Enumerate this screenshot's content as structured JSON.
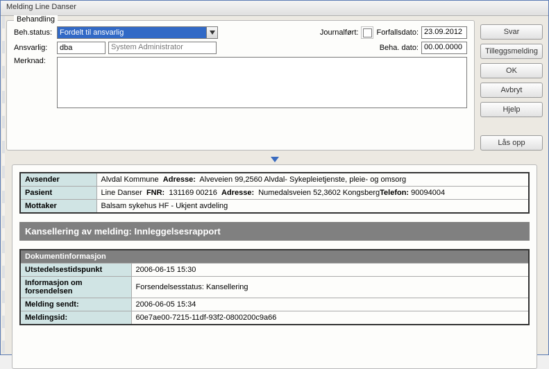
{
  "window": {
    "title": "Melding Line Danser"
  },
  "behandling": {
    "legend": "Behandling",
    "beh_status_label": "Beh.status:",
    "beh_status_value": "Fordelt til ansvarlig",
    "ansvarlig_label": "Ansvarlig:",
    "ansvarlig_value": "dba",
    "ansvarlig_name": "System Administrator",
    "merknad_label": "Merknad:",
    "journalfort_label": "Journalført:",
    "forfallsdato_label": "Forfallsdato:",
    "forfallsdato_value": "23.09.2012",
    "behadato_label": "Beha. dato:",
    "behadato_value": "00.00.0000"
  },
  "buttons": {
    "svar": "Svar",
    "tilleggsmelding": "Tilleggsmelding",
    "ok": "OK",
    "avbryt": "Avbryt",
    "hjelp": "Hjelp",
    "lasopp": "Lås opp"
  },
  "info": {
    "avsender_label": "Avsender",
    "avsender_name": "Alvdal Kommune",
    "avsender_adresse_label": "Adresse:",
    "avsender_adresse": "Alveveien 99,2560 Alvdal- Sykepleietjenste, pleie- og omsorg",
    "pasient_label": "Pasient",
    "pasient_name": "Line  Danser",
    "pasient_fnr_label": "FNR:",
    "pasient_fnr": "131169 00216",
    "pasient_adresse_label": "Adresse:",
    "pasient_adresse": "Numedalsveien 52,3602 Kongsberg",
    "pasient_telefon_label": "Telefon:",
    "pasient_telefon": "90094004",
    "mottaker_label": "Mottaker",
    "mottaker_value": "Balsam sykehus HF - Ukjent avdeling"
  },
  "section_title": "Kansellering av melding: Innleggelsesrapport",
  "doc": {
    "header": "Dokumentinformasjon",
    "utstedelse_label": "Utstedelsestidspunkt",
    "utstedelse_value": "2006-06-15 15:30",
    "forsendelse_label": "Informasjon om forsendelsen",
    "forsendelse_value": "Forsendelsesstatus: Kansellering",
    "sendt_label": "Melding sendt:",
    "sendt_value": "2006-06-05 15:34",
    "meldingsid_label": "Meldingsid:",
    "meldingsid_value": "60e7ae00-7215-11df-93f2-0800200c9a66"
  }
}
